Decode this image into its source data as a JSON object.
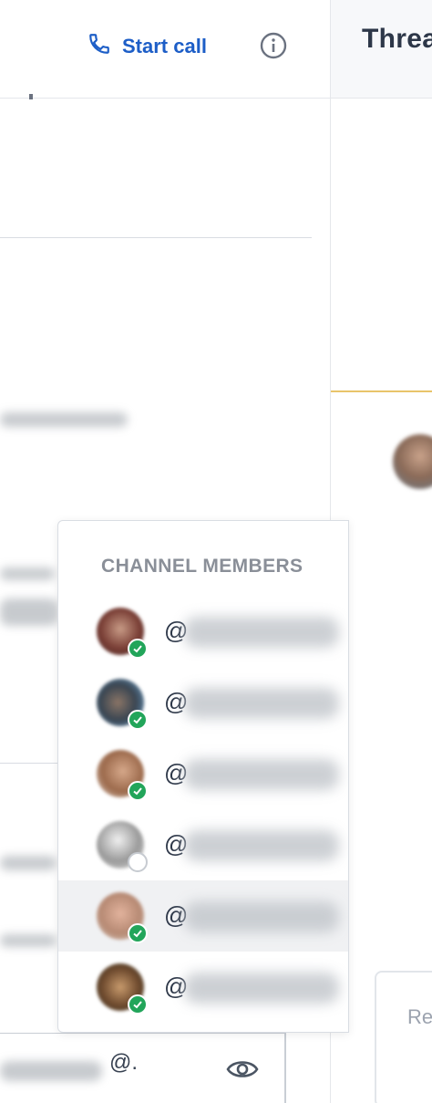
{
  "header": {
    "start_call_label": "Start call"
  },
  "thread": {
    "title": "Threa",
    "reply_placeholder": "Re"
  },
  "members_popup": {
    "heading": "CHANNEL MEMBERS",
    "members": [
      {
        "handle_prefix": "@",
        "status": "online",
        "selected": false
      },
      {
        "handle_prefix": "@",
        "status": "online",
        "selected": false
      },
      {
        "handle_prefix": "@",
        "status": "online",
        "selected": false
      },
      {
        "handle_prefix": "@",
        "status": "offline",
        "selected": false
      },
      {
        "handle_prefix": "@",
        "status": "online",
        "selected": true
      },
      {
        "handle_prefix": "@",
        "status": "online",
        "selected": false
      }
    ]
  },
  "composer": {
    "value": "@."
  },
  "colors": {
    "accent": "#1d5ec7",
    "online": "#22a55a",
    "thread_divider": "#e9c46a",
    "heading": "#8a8f98"
  },
  "icons": {
    "call": "phone-icon",
    "info": "info-icon",
    "preview": "eye-icon",
    "online_status": "check-icon"
  }
}
